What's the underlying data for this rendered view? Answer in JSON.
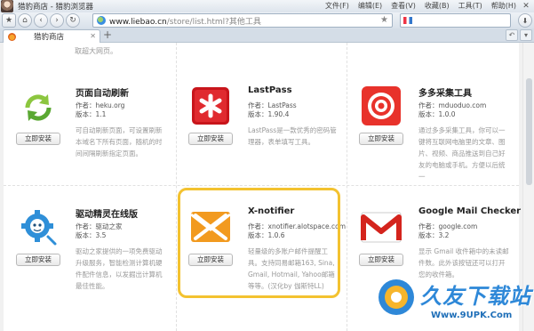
{
  "window": {
    "title": "猎豹商店 - 猎豹浏览器",
    "menu": [
      "文件(F)",
      "编辑(E)",
      "查看(V)",
      "收藏(B)",
      "工具(T)",
      "帮助(H)"
    ]
  },
  "toolbar": {
    "url_domain": "www.liebao.cn",
    "url_path": "/store/list.html?其他工具"
  },
  "tabs": [
    {
      "label": "猎豹商店"
    }
  ],
  "page": {
    "top_fragment": "取超大网页。",
    "install_label": "立即安装",
    "extensions": [
      {
        "name": "页面自动刷新",
        "author": "作者：heku.org",
        "version": "版本：1.1",
        "description": "可自动刷新页面，可设置刷新本域名下所有页面，随机的时间间隔刷新指定页面。"
      },
      {
        "name": "LastPass",
        "author": "作者：LastPass",
        "version": "版本：1.90.4",
        "description": "LastPass是一款优秀的密码管理器，表单填写工具。"
      },
      {
        "name": "多多采集工具",
        "author": "作者：mduoduo.com",
        "version": "版本：1.0.0",
        "description": "通过多多采集工具，你可以一键将互联网电脑里的文章、图片、视频、商品推送到自己好友的电脑或手机。方便以后统一"
      },
      {
        "name": "驱动精灵在线版",
        "author": "作者：驱动之家",
        "version": "版本：3.5",
        "description": "驱动之家提供的一项免费驱动升级服务，智能检测计算机硬件配件信息，以发掘出计算机最佳性能。"
      },
      {
        "name": "X-notifier",
        "author": "作者：xnotifier.alotspace.com",
        "version": "版本：1.0.6",
        "description": "轻量级的多账户邮件提醒工具。支持同易邮箱163, Sina, Gmail, Hotmail, Yahoo邮箱等等。(汉化by 伽斯特LL)"
      },
      {
        "name": "Google Mail Checker",
        "author": "作者：google.com",
        "version": "版本：3.2",
        "description": "显示 Gmail 收件箱中的未读邮件数。此外该按钮还可以打开您的收件箱。"
      }
    ]
  },
  "watermark": {
    "text": "久友下载站",
    "url": "Www.9UPK.Com"
  }
}
